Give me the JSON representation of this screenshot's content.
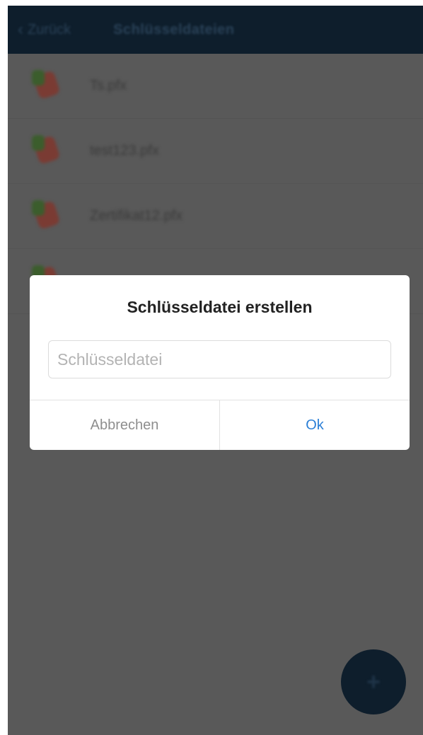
{
  "navbar": {
    "back_label": "Zurück",
    "title": "Schlüsseldateien"
  },
  "list": {
    "items": [
      {
        "label": "Ts.pfx"
      },
      {
        "label": "test123.pfx"
      },
      {
        "label": "Zertifikat12.pfx"
      }
    ]
  },
  "dialog": {
    "title": "Schlüsseldatei erstellen",
    "input_placeholder": "Schlüsseldatei",
    "input_value": "",
    "cancel_label": "Abbrechen",
    "ok_label": "Ok"
  },
  "fab": {
    "symbol": "+"
  },
  "colors": {
    "navbar": "#0e1e2c",
    "overlay": "#595959",
    "ok_button": "#2b7fd6",
    "cancel_button": "#8e8e8e"
  }
}
